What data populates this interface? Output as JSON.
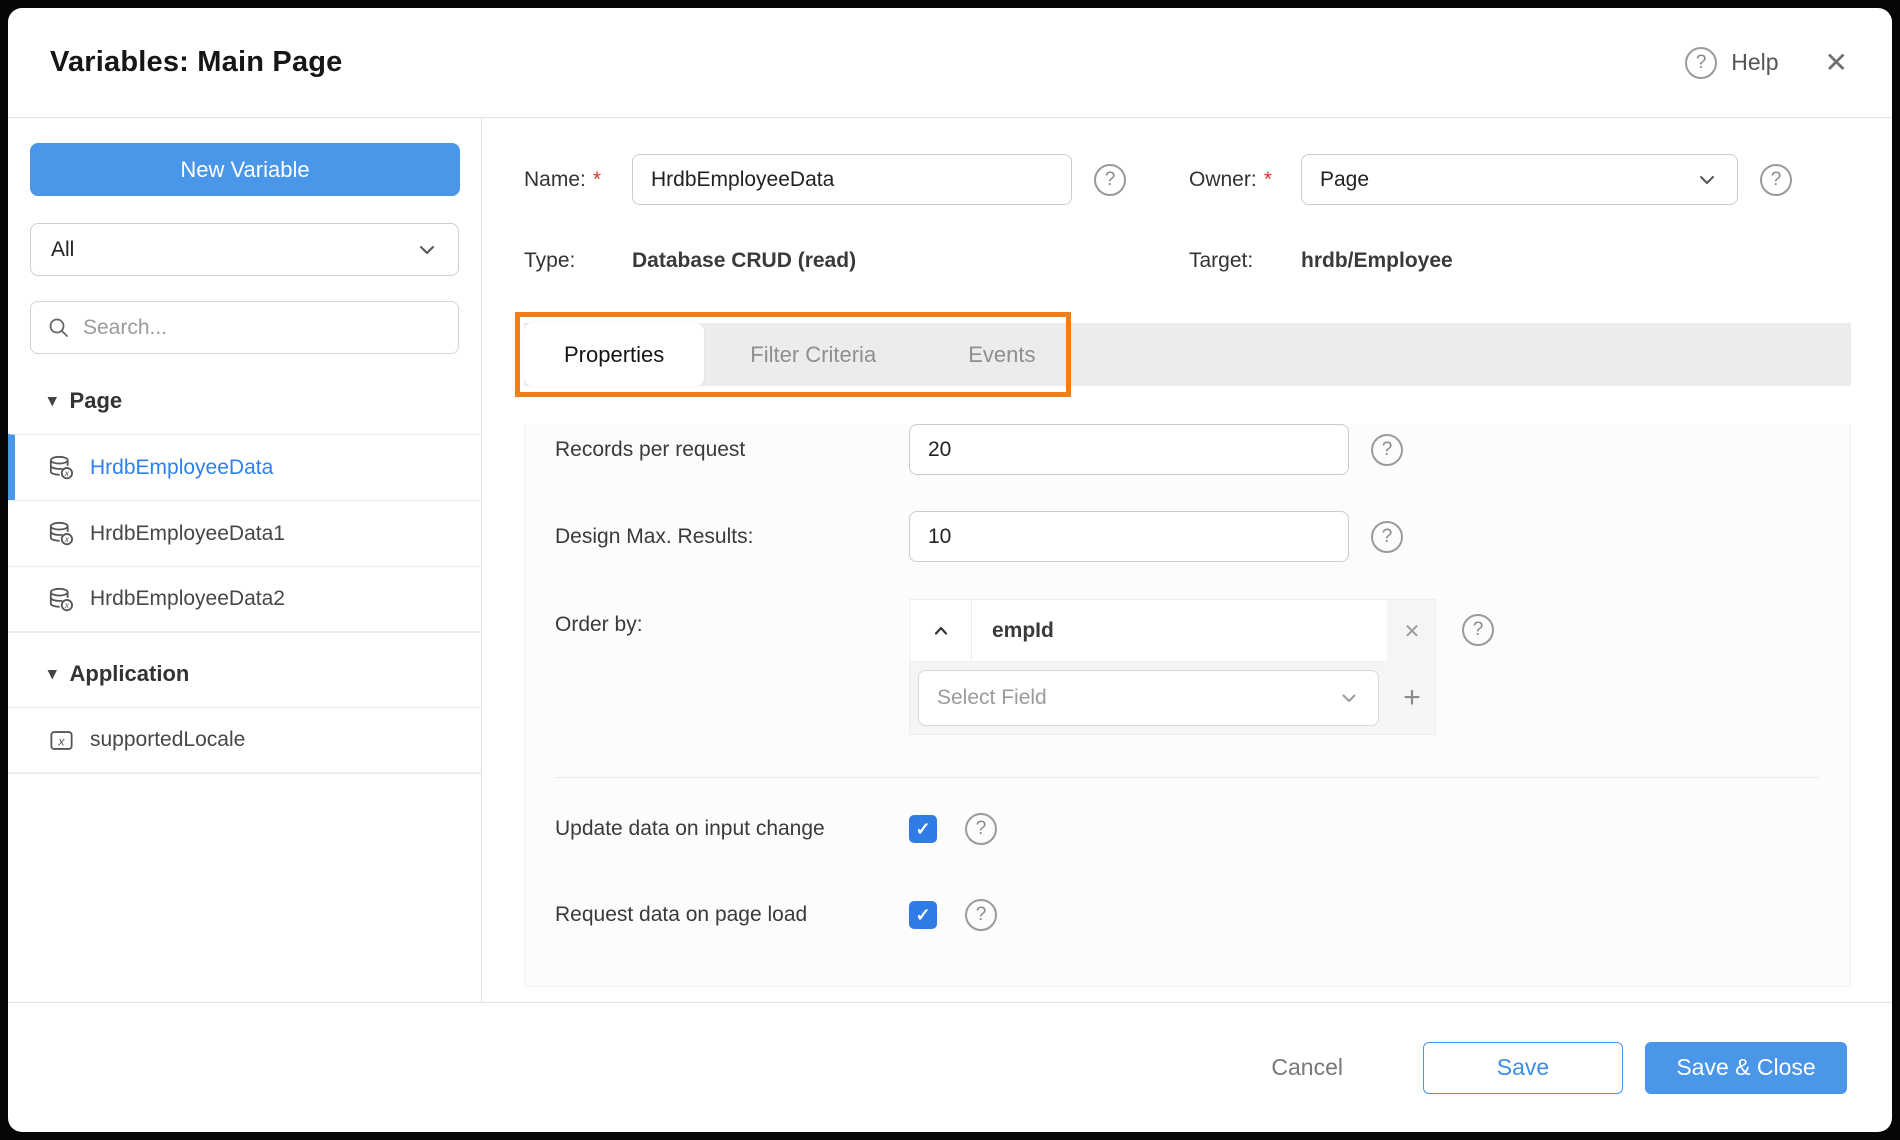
{
  "icons": {
    "question": "?",
    "close": "✕",
    "remove": "✕",
    "add": "+",
    "check": "✓",
    "caret_down": "▾"
  },
  "dialog": {
    "title": "Variables: Main Page",
    "help_label": "Help"
  },
  "sidebar": {
    "new_variable_label": "New Variable",
    "filter_value": "All",
    "search_placeholder": "Search...",
    "sections": [
      {
        "label": "Page",
        "items": [
          {
            "label": "HrdbEmployeeData",
            "selected": true
          },
          {
            "label": "HrdbEmployeeData1",
            "selected": false
          },
          {
            "label": "HrdbEmployeeData2",
            "selected": false
          }
        ]
      },
      {
        "label": "Application",
        "items": [
          {
            "label": "supportedLocale",
            "selected": false
          }
        ]
      }
    ]
  },
  "form": {
    "required_marker": "*",
    "name": {
      "label": "Name:",
      "value": "HrdbEmployeeData"
    },
    "owner": {
      "label": "Owner:",
      "value": "Page"
    },
    "type": {
      "label": "Type:",
      "value": "Database CRUD (read)"
    },
    "target": {
      "label": "Target:",
      "value": "hrdb/Employee"
    }
  },
  "tabs": [
    {
      "label": "Properties",
      "active": true
    },
    {
      "label": "Filter Criteria",
      "active": false
    },
    {
      "label": "Events",
      "active": false
    }
  ],
  "properties_panel": {
    "records_per_request": {
      "label": "Records per request",
      "value": "20"
    },
    "design_max_results": {
      "label": "Design Max. Results:",
      "value": "10"
    },
    "order_by": {
      "label": "Order by:",
      "field_value": "empId",
      "select_placeholder": "Select Field"
    },
    "update_on_input_change": {
      "label": "Update data on input change",
      "checked": true
    },
    "request_on_page_load": {
      "label": "Request data on page load",
      "checked": true
    }
  },
  "footer": {
    "cancel_label": "Cancel",
    "save_label": "Save",
    "save_close_label": "Save & Close"
  },
  "colors": {
    "accent_blue": "#4a96e8",
    "link_blue": "#2f80ed",
    "highlight_orange": "#ee7f1d",
    "checkbox_blue": "#2e7ce4",
    "required_red": "#d93a2f"
  }
}
